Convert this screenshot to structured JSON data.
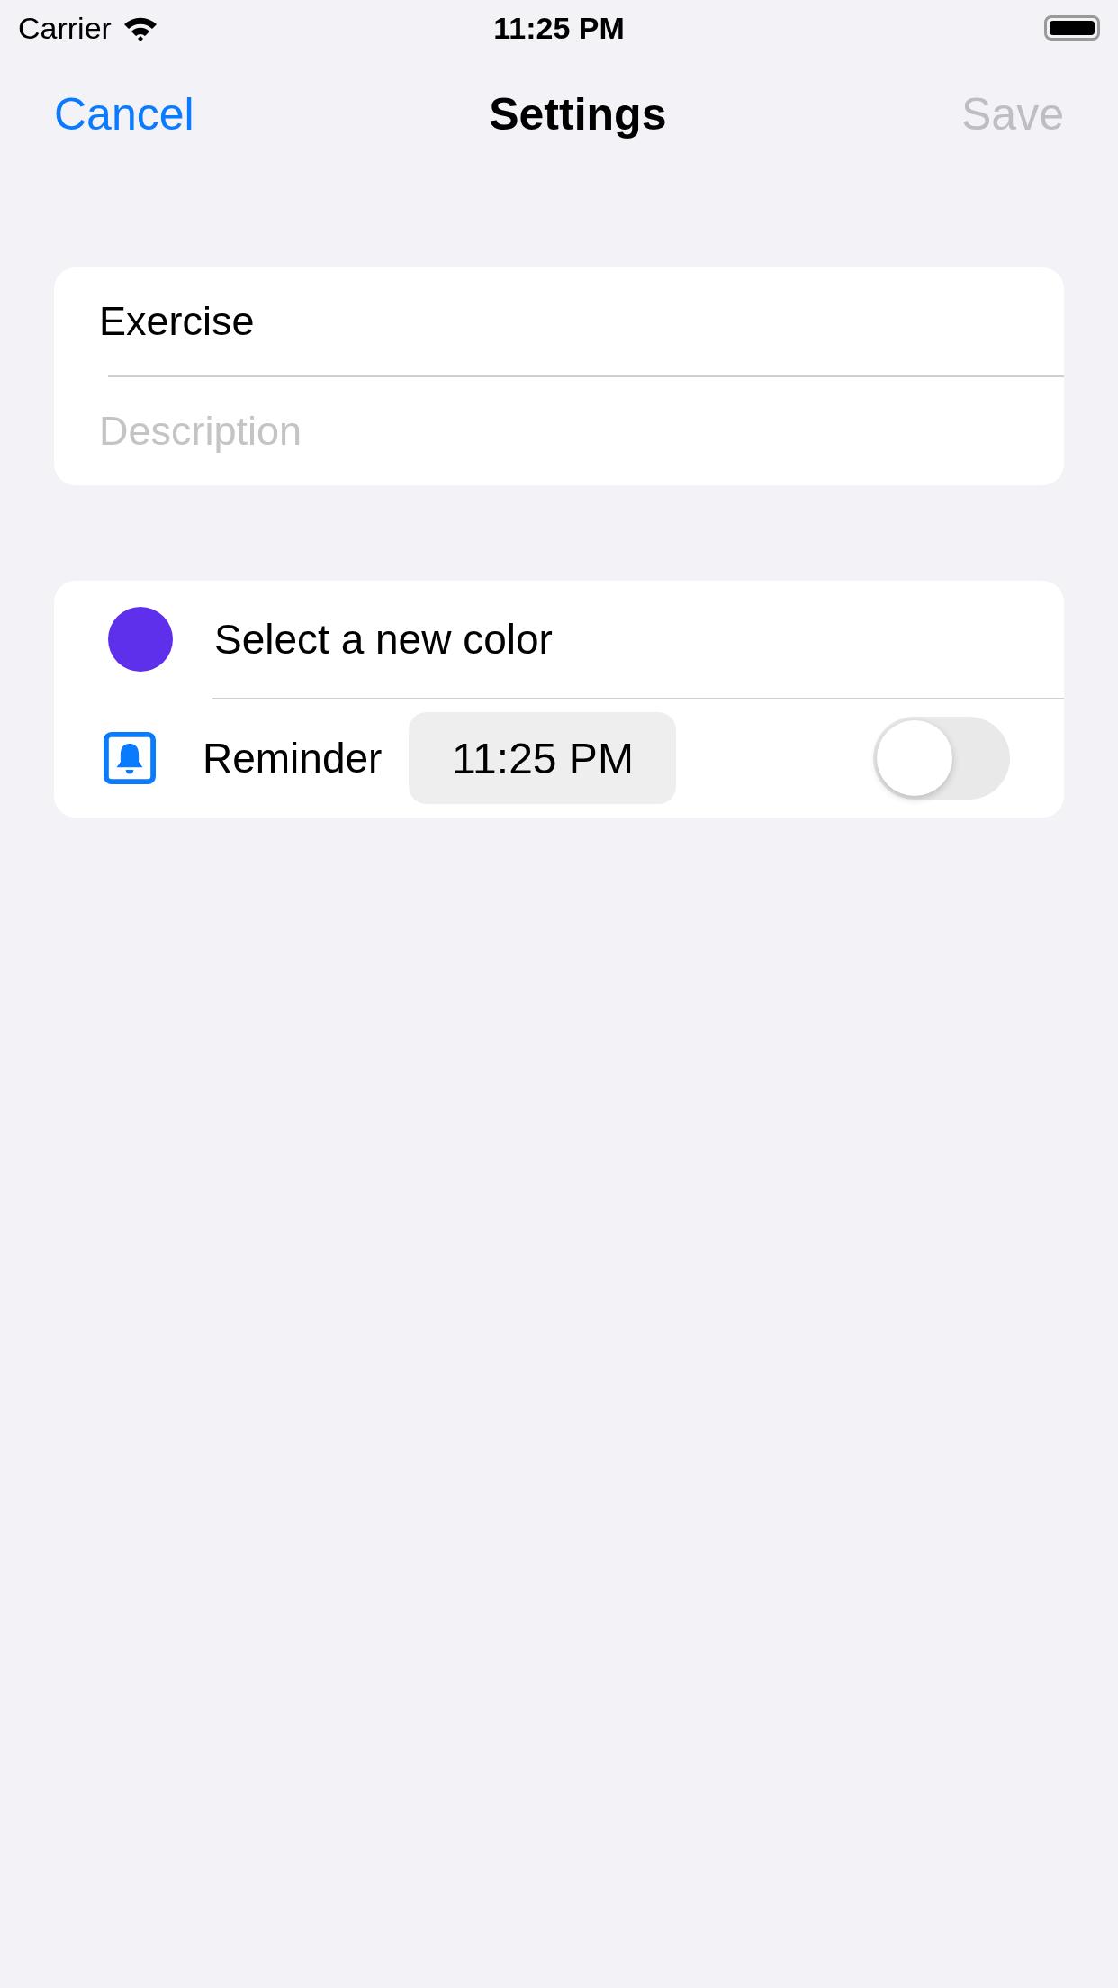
{
  "status_bar": {
    "carrier": "Carrier",
    "time": "11:25 PM"
  },
  "nav_bar": {
    "cancel": "Cancel",
    "title": "Settings",
    "save": {
      "label": "Save",
      "disabled": true
    }
  },
  "form": {
    "name": {
      "value": "Exercise"
    },
    "description": {
      "placeholder": "Description"
    }
  },
  "options": {
    "color": {
      "label": "Select a new color",
      "color": "#5e30eb"
    },
    "reminder": {
      "label": "Reminder",
      "time": "11:25 PM",
      "on": false
    }
  }
}
